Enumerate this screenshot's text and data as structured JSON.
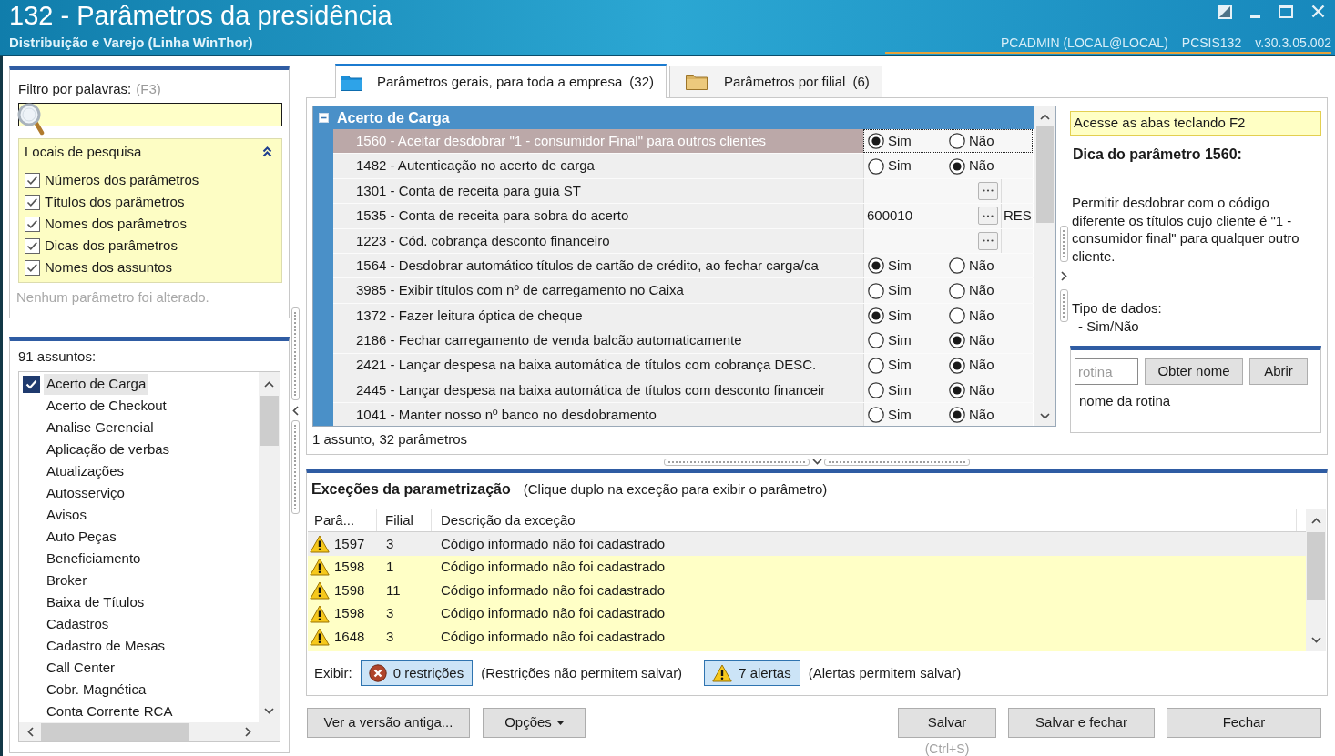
{
  "window": {
    "title": "132 - Parâmetros da presidência",
    "subtitle": "Distribuição e Varejo (Linha WinThor)",
    "user": "PCADMIN (LOCAL@LOCAL)",
    "program": "PCSIS132",
    "version": "v.30.3.05.002"
  },
  "filter": {
    "label": "Filtro por palavras:",
    "shortcut": "(F3)",
    "search_locations": {
      "title": "Locais de pesquisa",
      "expanded": true,
      "options": [
        {
          "label": "Números dos parâmetros",
          "checked": true
        },
        {
          "label": "Títulos dos parâmetros",
          "checked": true
        },
        {
          "label": "Nomes dos parâmetros",
          "checked": true
        },
        {
          "label": "Dicas dos parâmetros",
          "checked": true
        },
        {
          "label": "Nomes dos assuntos",
          "checked": true
        }
      ]
    },
    "status": "Nenhum parâmetro foi alterado."
  },
  "subjects": {
    "label": "91 assuntos:",
    "items": [
      {
        "label": "Acerto de Carga",
        "checked": true,
        "selected": true
      },
      {
        "label": "Acerto de Checkout",
        "checked": false,
        "selected": false
      },
      {
        "label": "Analise Gerencial",
        "checked": false,
        "selected": false
      },
      {
        "label": "Aplicação de verbas",
        "checked": false,
        "selected": false
      },
      {
        "label": "Atualizações",
        "checked": false,
        "selected": false
      },
      {
        "label": "Autosserviço",
        "checked": false,
        "selected": false
      },
      {
        "label": "Avisos",
        "checked": false,
        "selected": false
      },
      {
        "label": "Auto Peças",
        "checked": false,
        "selected": false
      },
      {
        "label": "Beneficiamento",
        "checked": false,
        "selected": false
      },
      {
        "label": "Broker",
        "checked": false,
        "selected": false
      },
      {
        "label": "Baixa de Títulos",
        "checked": false,
        "selected": false
      },
      {
        "label": "Cadastros",
        "checked": false,
        "selected": false
      },
      {
        "label": "Cadastro de Mesas",
        "checked": false,
        "selected": false
      },
      {
        "label": "Call Center",
        "checked": false,
        "selected": false
      },
      {
        "label": "Cobr. Magnética",
        "checked": false,
        "selected": false
      },
      {
        "label": "Conta Corrente RCA",
        "checked": false,
        "selected": false
      }
    ]
  },
  "tabs": [
    {
      "label": "Parâmetros gerais, para toda a empresa",
      "count": "(32)",
      "selected": true
    },
    {
      "label": "Parâmetros por filial",
      "count": "(6)",
      "selected": false
    }
  ],
  "parameters": {
    "group": {
      "title": "Acerto de Carga",
      "expanded": true
    },
    "rows": [
      {
        "label": "1560 - Aceitar desdobrar \"1 - consumidor Final\" para outros clientes",
        "selected": true,
        "kind": "yes_no",
        "options": [
          {
            "label": "Sim",
            "selected": true
          },
          {
            "label": "Não",
            "selected": false
          }
        ]
      },
      {
        "label": "1482 - Autenticação no acerto de carga",
        "selected": false,
        "kind": "yes_no",
        "options": [
          {
            "label": "Sim",
            "selected": false
          },
          {
            "label": "Não",
            "selected": true
          }
        ]
      },
      {
        "label": "1301 - Conta de receita para guia ST",
        "selected": false,
        "kind": "lookup"
      },
      {
        "label": "1535 - Conta de receita para sobra do acerto",
        "selected": false,
        "kind": "lookup",
        "value": "600010",
        "extra": "RES"
      },
      {
        "label": "1223 - Cód. cobrança desconto financeiro",
        "selected": false,
        "kind": "lookup"
      },
      {
        "label": "1564 - Desdobrar automático títulos de cartão de crédito, ao fechar carga/ca",
        "selected": false,
        "kind": "yes_no",
        "options": [
          {
            "label": "Sim",
            "selected": true
          },
          {
            "label": "Não",
            "selected": false
          }
        ]
      },
      {
        "label": "3985 - Exibir títulos com nº de carregamento no Caixa",
        "selected": false,
        "kind": "yes_no",
        "options": [
          {
            "label": "Sim",
            "selected": false
          },
          {
            "label": "Não",
            "selected": false
          }
        ]
      },
      {
        "label": "1372 - Fazer leitura óptica de cheque",
        "selected": false,
        "kind": "yes_no",
        "options": [
          {
            "label": "Sim",
            "selected": true
          },
          {
            "label": "Não",
            "selected": false
          }
        ]
      },
      {
        "label": "2186 - Fechar carregamento de venda balcão automaticamente",
        "selected": false,
        "kind": "yes_no",
        "options": [
          {
            "label": "Sim",
            "selected": false
          },
          {
            "label": "Não",
            "selected": true
          }
        ]
      },
      {
        "label": "2421 - Lançar despesa na baixa automática de títulos com cobrança DESC.",
        "selected": false,
        "kind": "yes_no",
        "options": [
          {
            "label": "Sim",
            "selected": false
          },
          {
            "label": "Não",
            "selected": true
          }
        ]
      },
      {
        "label": "2445 - Lançar despesa na baixa automática de títulos com desconto financeir",
        "selected": false,
        "kind": "yes_no",
        "options": [
          {
            "label": "Sim",
            "selected": false
          },
          {
            "label": "Não",
            "selected": true
          }
        ]
      },
      {
        "label": "1041 - Manter nosso nº banco no desdobramento",
        "selected": false,
        "kind": "yes_no",
        "options": [
          {
            "label": "Sim",
            "selected": false
          },
          {
            "label": "Não",
            "selected": true
          }
        ]
      }
    ],
    "summary": "1 assunto, 32 parâmetros"
  },
  "hint": {
    "note": "Acesse as abas teclando F2",
    "title": "Dica do parâmetro 1560:",
    "description": "Permitir desdobrar com o código diferente os títulos cujo cliente é \"1 - consumidor final\" para qualquer outro cliente.",
    "data_type_label": "Tipo de dados:",
    "data_type": "- Sim/Não"
  },
  "routine": {
    "placeholder": "rotina",
    "buttons": [
      "Obter nome",
      "Abrir"
    ],
    "name_label": "nome da rotina"
  },
  "exceptions": {
    "title": "Exceções da parametrização",
    "note": "(Clique duplo na exceção para exibir o parâmetro)",
    "columns": [
      "Parâ...",
      "Filial",
      "Descrição da exceção"
    ],
    "rows": [
      {
        "kind": "alert",
        "selected": true,
        "cells": [
          "1597",
          "3",
          "Código informado não foi cadastrado"
        ]
      },
      {
        "kind": "alert",
        "selected": false,
        "cells": [
          "1598",
          "1",
          "Código informado não foi cadastrado"
        ]
      },
      {
        "kind": "alert",
        "selected": false,
        "cells": [
          "1598",
          "11",
          "Código informado não foi cadastrado"
        ]
      },
      {
        "kind": "alert",
        "selected": false,
        "cells": [
          "1598",
          "3",
          "Código informado não foi cadastrado"
        ]
      },
      {
        "kind": "alert",
        "selected": false,
        "cells": [
          "1648",
          "3",
          "Código informado não foi cadastrado"
        ]
      }
    ],
    "filter_label": "Exibir:",
    "filters": [
      {
        "kind": "restriction",
        "label": "0 restrições",
        "note": "(Restrições não permitem salvar)",
        "on": true
      },
      {
        "kind": "alert",
        "label": "7 alertas",
        "note": "(Alertas permitem salvar)",
        "on": true
      }
    ]
  },
  "footer": {
    "left_buttons": [
      {
        "label": "Ver a versão antiga...",
        "kind": "plain"
      },
      {
        "label": "Opções",
        "kind": "menu"
      }
    ],
    "right_buttons": [
      {
        "label": "Salvar",
        "shortcut": "(Ctrl+S)"
      },
      {
        "label": "Salvar e fechar"
      },
      {
        "label": "Fechar"
      }
    ]
  }
}
